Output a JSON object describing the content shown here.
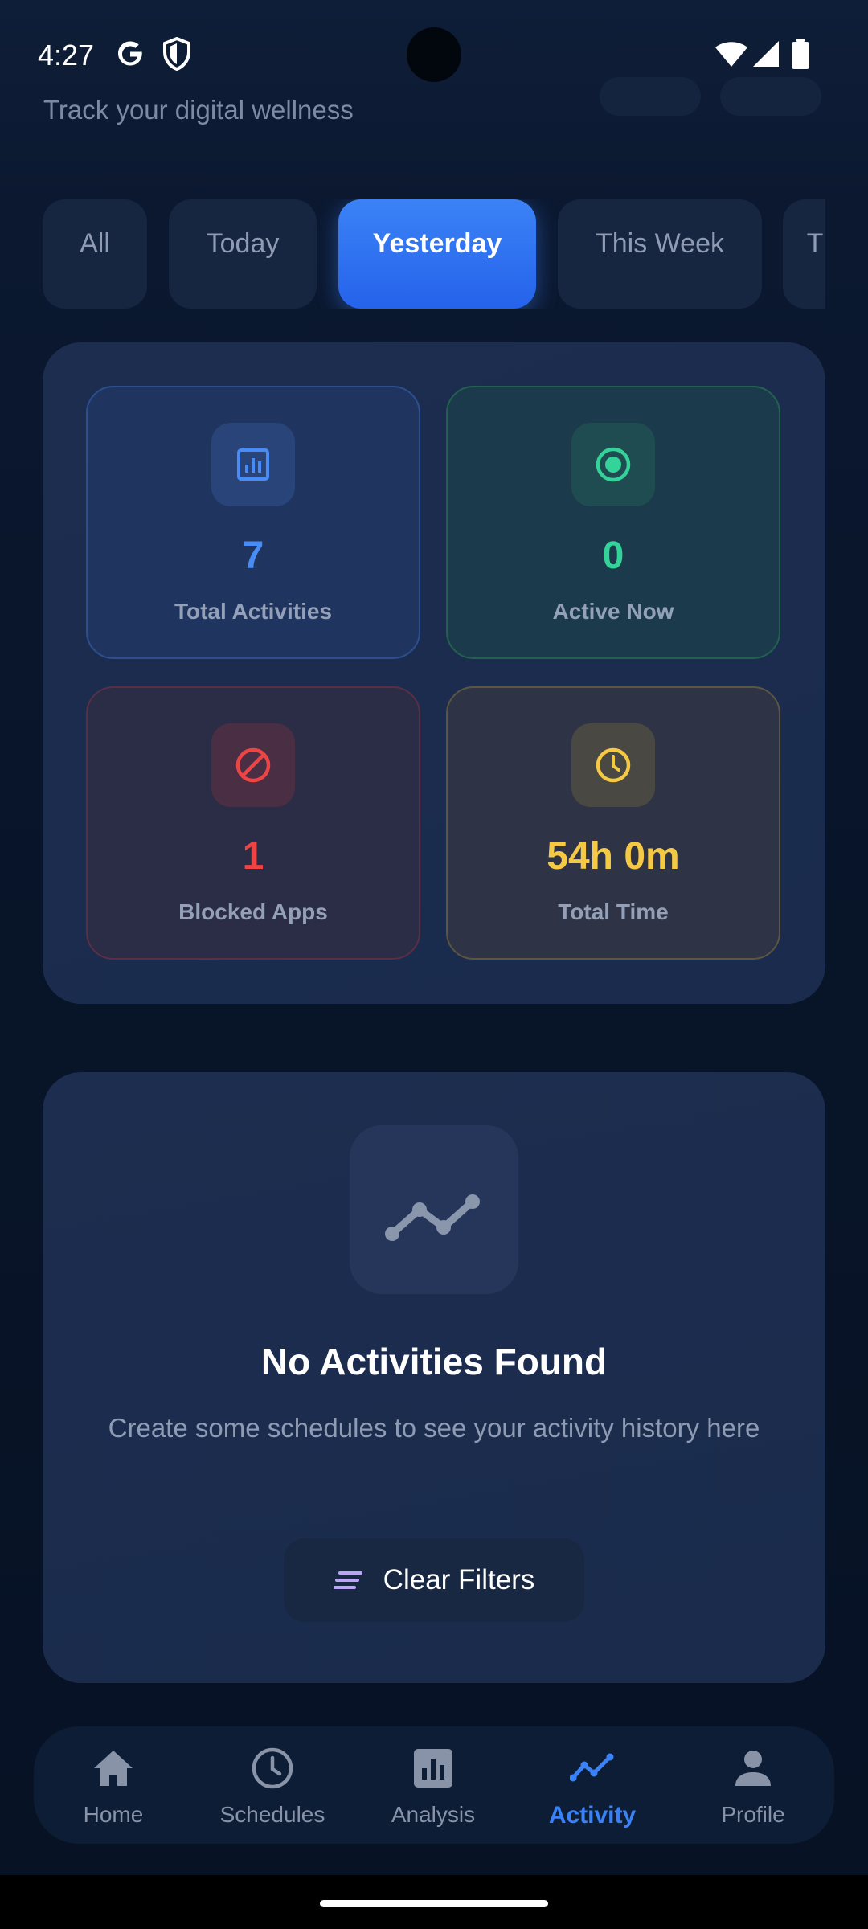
{
  "status_bar": {
    "time": "4:27"
  },
  "header": {
    "subtitle": "Track your digital wellness"
  },
  "filters": [
    {
      "label": "All",
      "active": false
    },
    {
      "label": "Today",
      "active": false
    },
    {
      "label": "Yesterday",
      "active": true
    },
    {
      "label": "This Week",
      "active": false
    },
    {
      "label": "T",
      "active": false
    }
  ],
  "stats": {
    "total_activities": {
      "value": "7",
      "label": "Total Activities",
      "icon": "bar-chart-icon",
      "color": "#4a8cf5"
    },
    "active_now": {
      "value": "0",
      "label": "Active Now",
      "icon": "radio-button-icon",
      "color": "#34d399"
    },
    "blocked_apps": {
      "value": "1",
      "label": "Blocked Apps",
      "icon": "block-icon",
      "color": "#ef4444"
    },
    "total_time": {
      "value": "54h 0m",
      "label": "Total Time",
      "icon": "clock-icon",
      "color": "#f6c945"
    }
  },
  "empty_state": {
    "icon": "trending-line-icon",
    "title": "No Activities Found",
    "description": "Create some schedules to see your activity history here",
    "clear_button": "Clear Filters"
  },
  "bottom_nav": [
    {
      "label": "Home",
      "icon": "home-icon",
      "active": false
    },
    {
      "label": "Schedules",
      "icon": "schedule-clock-icon",
      "active": false
    },
    {
      "label": "Analysis",
      "icon": "analytics-icon",
      "active": false
    },
    {
      "label": "Activity",
      "icon": "activity-line-icon",
      "active": true
    },
    {
      "label": "Profile",
      "icon": "person-icon",
      "active": false
    }
  ],
  "colors": {
    "accent": "#3b82f6",
    "background": "#0a1628",
    "panel": "#1c2d4f"
  }
}
